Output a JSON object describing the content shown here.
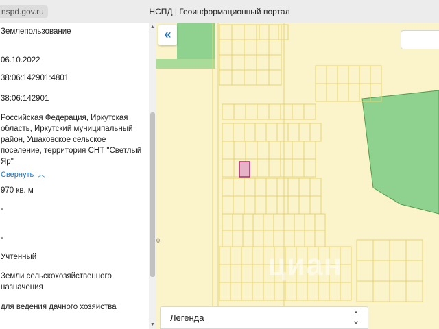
{
  "browser": {
    "url": "nspd.gov.ru",
    "title": "НСПД | Геоинформационный портал"
  },
  "parcel": {
    "fields": [
      {
        "key": "land_use_type",
        "value": "Землепользование"
      },
      {
        "key": "date",
        "value": "06.10.2022"
      },
      {
        "key": "cadastral_number",
        "value": "38:06:142901:4801"
      },
      {
        "key": "cadastral_quarter",
        "value": "38:06:142901"
      },
      {
        "key": "address",
        "value": "Российская Федерация, Иркутская область, Иркутский муниципальный район, Ушаковское сельское поселение, территория СНТ \"Светлый Яр\""
      },
      {
        "key": "area",
        "value": "970 кв. м"
      },
      {
        "key": "dash_1",
        "value": "-"
      },
      {
        "key": "dash_2",
        "value": "-"
      },
      {
        "key": "status",
        "value": "Учтенный"
      },
      {
        "key": "category",
        "value": "Земли сельскохозяйственного назначения"
      },
      {
        "key": "permitted_use",
        "value": "для ведения дачного хозяйства"
      }
    ],
    "collapse_label": "Свернуть"
  },
  "map": {
    "legend_label": "Легенда",
    "axis_label": "0",
    "watermark": "циан",
    "colors": {
      "background": "#fbf3c9",
      "plot_outline": "#e6d573",
      "forest": "#8fd28f",
      "forest_edge": "#4e9c4e",
      "selected_fill": "#e6b2c8",
      "selected_outline": "#b3246d",
      "accent": "#1a73c9"
    },
    "icons": {
      "collapse": "double-chevron-left-icon",
      "legend": "up-down-chevron-icon"
    }
  }
}
